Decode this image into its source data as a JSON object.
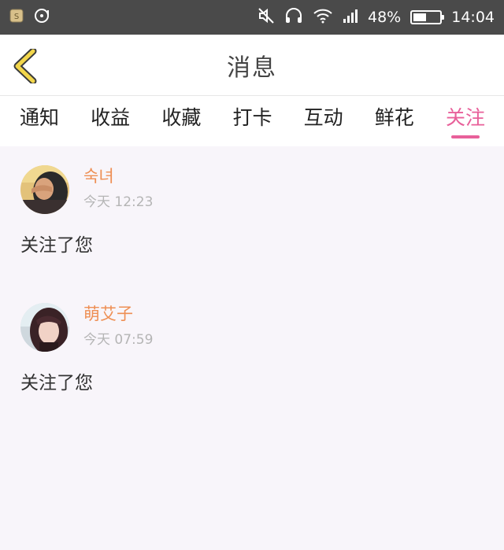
{
  "status_bar": {
    "battery_percent": "48%",
    "time": "14:04",
    "battery_level": 0.48,
    "icons": [
      "sim-card-icon",
      "music-icon",
      "mute-icon",
      "headphones-icon",
      "wifi-icon",
      "signal-icon",
      "battery-icon"
    ]
  },
  "header": {
    "title": "消息",
    "back_icon": "chevron-left-icon",
    "accent_color": "#f2d64b"
  },
  "tabs": [
    {
      "label": "通知",
      "active": false
    },
    {
      "label": "收益",
      "active": false
    },
    {
      "label": "收藏",
      "active": false
    },
    {
      "label": "打卡",
      "active": false
    },
    {
      "label": "互动",
      "active": false
    },
    {
      "label": "鲜花",
      "active": false
    },
    {
      "label": "关注",
      "active": true
    }
  ],
  "colors": {
    "active_tab": "#e8609a",
    "username": "#ee8f54",
    "time": "#b5b5b5"
  },
  "messages": [
    {
      "user": "숙녀",
      "time": "今天 12:23",
      "text": "关注了您"
    },
    {
      "user": "萌艾子",
      "time": "今天 07:59",
      "text": "关注了您"
    }
  ]
}
